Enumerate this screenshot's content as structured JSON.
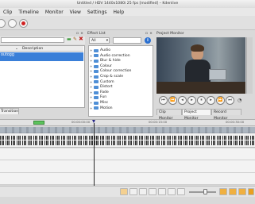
{
  "window": {
    "title": "Untitled / HDV 1440x1080i 25 fps [modified] – Kdenlive"
  },
  "menu": [
    "Clip",
    "Timeline",
    "Monitor",
    "View",
    "Settings",
    "Help"
  ],
  "project_tree": {
    "col_description": "Description",
    "clip_name": "outogg",
    "tab_label": "Transition"
  },
  "effect_list": {
    "title": "Effect List",
    "filter_value": "All",
    "items": [
      "Audio",
      "Audio correction",
      "Blur & hide",
      "Colour",
      "Colour correction",
      "Crop & scale",
      "Custom",
      "Distort",
      "Fade",
      "Fun",
      "Misc",
      "Motion"
    ]
  },
  "project_monitor": {
    "title": "Project Monitor",
    "tabs": [
      "Clip Monitor",
      "Project Monitor",
      "Record Monitor"
    ]
  },
  "timeline": {
    "ruler_marks": [
      "00:00:00:00",
      "00:00:15:00",
      "00:00:30:00"
    ]
  },
  "colors": {
    "selection_blue": "#3a7fd8",
    "playhead": "#2a2a8a",
    "marker_green": "#5cc35c",
    "bottom_accent": "#e8a020"
  }
}
